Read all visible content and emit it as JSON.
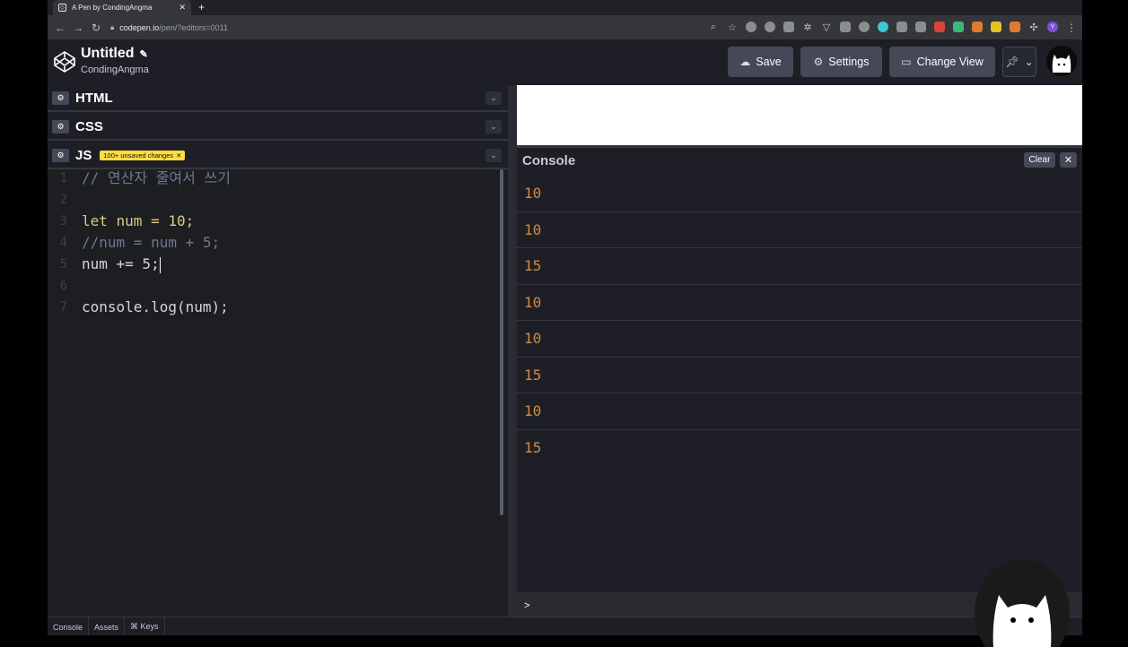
{
  "browser": {
    "tab_title": "A Pen by CondingAngma",
    "tab_close": "✕",
    "new_tab": "+",
    "url_host": "codepen.io",
    "url_path": "/pen/?editors=0011",
    "nav": {
      "back": "←",
      "forward": "→",
      "reload": "↻"
    },
    "profile_initial": "Y"
  },
  "header": {
    "title": "Untitled",
    "author": "CondingAngma",
    "save_label": "Save",
    "settings_label": "Settings",
    "change_view_label": "Change View"
  },
  "editors": {
    "html_label": "HTML",
    "css_label": "CSS",
    "js_label": "JS",
    "unsaved_badge": "100+ unsaved changes",
    "code_lines": [
      {
        "n": "1",
        "text": "// 연산자 줄여서 쓰기"
      },
      {
        "n": "2",
        "text": ""
      },
      {
        "n": "3",
        "text": "let num = 10;"
      },
      {
        "n": "4",
        "text": "//num = num + 5;"
      },
      {
        "n": "5",
        "text": "num += 5;"
      },
      {
        "n": "6",
        "text": ""
      },
      {
        "n": "7",
        "text": "console.log(num);"
      }
    ]
  },
  "console": {
    "title": "Console",
    "clear_label": "Clear",
    "close_label": "✕",
    "outputs": [
      "10",
      "10",
      "15",
      "10",
      "10",
      "15",
      "10",
      "15"
    ],
    "prompt": ">"
  },
  "footer": {
    "tabs": [
      "Console",
      "Assets",
      "⌘ Keys"
    ]
  },
  "colors": {
    "background": "#131417",
    "panel": "#1e1f26",
    "button": "#444857",
    "number": "#d08a42",
    "keyword": "#ddca7e",
    "badge": "#ffdd40"
  }
}
